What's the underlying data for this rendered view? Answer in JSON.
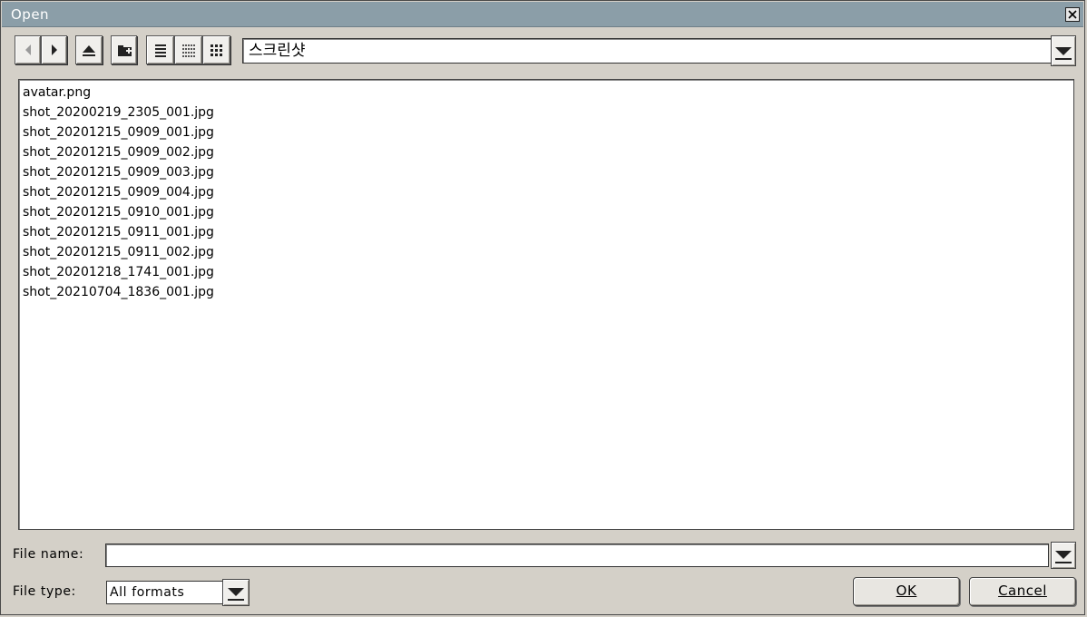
{
  "window": {
    "title": "Open"
  },
  "toolbar": {
    "buttons": [
      "back-icon",
      "forward-icon",
      "up-icon",
      "new-folder-icon",
      "list-view-icon",
      "small-icons-view-icon",
      "large-icons-view-icon"
    ]
  },
  "path": {
    "value": "스크린샷"
  },
  "files": [
    "avatar.png",
    "shot_20200219_2305_001.jpg",
    "shot_20201215_0909_001.jpg",
    "shot_20201215_0909_002.jpg",
    "shot_20201215_0909_003.jpg",
    "shot_20201215_0909_004.jpg",
    "shot_20201215_0910_001.jpg",
    "shot_20201215_0911_001.jpg",
    "shot_20201215_0911_002.jpg",
    "shot_20201218_1741_001.jpg",
    "shot_20210704_1836_001.jpg"
  ],
  "filename": {
    "label": "File name:",
    "value": ""
  },
  "filetype": {
    "label": "File type:",
    "value": "All formats"
  },
  "actions": {
    "ok": "OK",
    "cancel": "Cancel"
  },
  "colors": {
    "titlebar": "#8b9ea8",
    "face": "#d4d0c8"
  }
}
